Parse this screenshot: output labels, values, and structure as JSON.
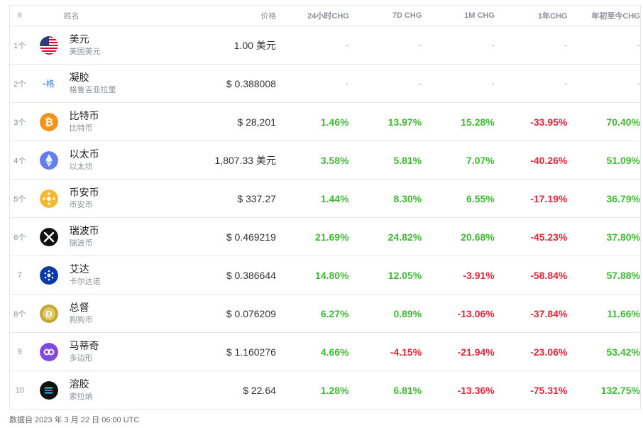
{
  "header": {
    "rank": "#",
    "name": "姓名",
    "price": "价格",
    "chg24h": "24小时CHG",
    "chg7d": "7D CHG",
    "chg1m": "1M CHG",
    "chg1y": "1年CHG",
    "chgytd": "年初至今CHG"
  },
  "rows": [
    {
      "rank": "1个",
      "name": "美元",
      "sub": "美国美元",
      "price": "1.00 美元",
      "c24": "-",
      "c7": "-",
      "c1m": "-",
      "c1y": "-",
      "cytd": "-",
      "icon": "usd-flag-icon"
    },
    {
      "rank": "2个",
      "name": "凝胶",
      "sub": "格鲁吉亚拉里",
      "price": "$ 0.388008",
      "c24": "-",
      "c7": "-",
      "c1m": "-",
      "c1y": "-",
      "cytd": "-",
      "icon": "broken-image-icon",
      "alt": "格"
    },
    {
      "rank": "3个",
      "name": "比特币",
      "sub": "比特币",
      "price": "$ 28,201",
      "c24": "1.46%",
      "c7": "13.97%",
      "c1m": "15.28%",
      "c1y": "-33.95%",
      "cytd": "70.40%",
      "icon": "bitcoin-icon"
    },
    {
      "rank": "4个",
      "name": "以太币",
      "sub": "以太坊",
      "price": "1,807.33 美元",
      "c24": "3.58%",
      "c7": "5.81%",
      "c1m": "7.07%",
      "c1y": "-40.26%",
      "cytd": "51.09%",
      "icon": "ethereum-icon"
    },
    {
      "rank": "5个",
      "name": "币安币",
      "sub": "币安币",
      "price": "$ 337.27",
      "c24": "1.44%",
      "c7": "8.30%",
      "c1m": "6.55%",
      "c1y": "-17.19%",
      "cytd": "36.79%",
      "icon": "binance-icon"
    },
    {
      "rank": "6个",
      "name": "瑞波币",
      "sub": "瑞波币",
      "price": "$ 0.469219",
      "c24": "21.69%",
      "c7": "24.82%",
      "c1m": "20.68%",
      "c1y": "-45.23%",
      "cytd": "37.80%",
      "icon": "xrp-icon"
    },
    {
      "rank": "7",
      "name": "艾达",
      "sub": "卡尔达诺",
      "price": "$ 0.386644",
      "c24": "14.80%",
      "c7": "12.05%",
      "c1m": "-3.91%",
      "c1y": "-58.84%",
      "cytd": "57.88%",
      "icon": "cardano-icon"
    },
    {
      "rank": "8个",
      "name": "总督",
      "sub": "狗狗币",
      "price": "$ 0.076209",
      "c24": "6.27%",
      "c7": "0.89%",
      "c1m": "-13.06%",
      "c1y": "-37.84%",
      "cytd": "11.66%",
      "icon": "dogecoin-icon"
    },
    {
      "rank": "9",
      "name": "马蒂奇",
      "sub": "多边形",
      "price": "$ 1.160276",
      "c24": "4.66%",
      "c7": "-4.15%",
      "c1m": "-21.94%",
      "c1y": "-23.06%",
      "cytd": "53.42%",
      "icon": "polygon-icon"
    },
    {
      "rank": "10",
      "name": "溶胶",
      "sub": "索拉纳",
      "price": "$ 22.64",
      "c24": "1.28%",
      "c7": "6.81%",
      "c1m": "-13.36%",
      "c1y": "-75.31%",
      "cytd": "132.75%",
      "icon": "solana-icon"
    }
  ],
  "footer": "数据自 2023 年 3 月 22 日 06:00 UTC",
  "colors": {
    "positive": "#3fb934",
    "negative": "#e2263b",
    "border": "#e6e8eb"
  }
}
